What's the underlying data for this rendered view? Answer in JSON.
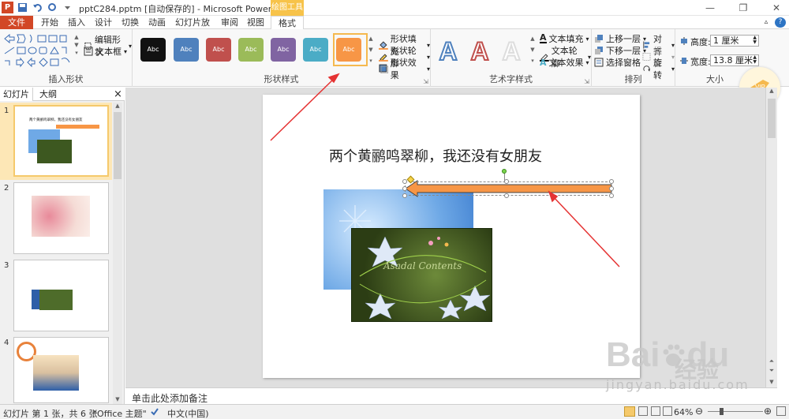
{
  "window": {
    "title": "pptC284.pptm [自动保存的] - Microsoft PowerPoint",
    "context_tab_title": "绘图工具",
    "app_icon": "P"
  },
  "tabs": [
    "文件",
    "开始",
    "插入",
    "设计",
    "切换",
    "动画",
    "幻灯片放映",
    "审阅",
    "视图",
    "格式"
  ],
  "ribbon": {
    "insert_shapes": {
      "edit_shape": "编辑形状",
      "text_box": "文本框",
      "label": "插入形状"
    },
    "shape_styles": {
      "swatches": [
        {
          "label": "Abc",
          "color": "#111111"
        },
        {
          "label": "Abc",
          "color": "#4f81bd"
        },
        {
          "label": "Abc",
          "color": "#c0504d"
        },
        {
          "label": "Abc",
          "color": "#9bbb59"
        },
        {
          "label": "Abc",
          "color": "#8064a2"
        },
        {
          "label": "Abc",
          "color": "#4bacc6"
        },
        {
          "label": "Abc",
          "color": "#f79646"
        }
      ],
      "fill": "形状填充",
      "outline": "形状轮廓",
      "effects": "形状效果",
      "label": "形状样式"
    },
    "wordart": {
      "samples": [
        {
          "text": "A",
          "color": "#4f81bd"
        },
        {
          "text": "A",
          "color": "#c0504d"
        },
        {
          "text": "A",
          "color": "#dddddd"
        }
      ],
      "text_fill": "文本填充",
      "text_outline": "文本轮廓",
      "text_effects": "文本效果",
      "label": "艺术字样式"
    },
    "arrange": {
      "bring_forward": "上移一层",
      "send_backward": "下移一层",
      "selection_pane": "选择窗格",
      "align": "对齐",
      "group": "组合",
      "rotate": "旋转",
      "label": "排列"
    },
    "size": {
      "height_label": "高度:",
      "height_value": "1 厘米",
      "width_label": "宽度:",
      "width_value": "13.8 厘米",
      "label": "大小"
    }
  },
  "left_panel": {
    "tab_slides": "幻灯片",
    "tab_outline": "大纲",
    "close": "×",
    "thumbnails": [
      {
        "num": "1",
        "title": "两个黄鹂鸣翠柳，我还没有女朋友"
      },
      {
        "num": "2"
      },
      {
        "num": "3"
      },
      {
        "num": "4"
      }
    ]
  },
  "slide": {
    "title": "两个黄鹂鸣翠柳，我还没有女朋友",
    "image_text": "Asadal Contents",
    "arrow_color": "#f79646"
  },
  "notes": {
    "placeholder": "单击此处添加备注"
  },
  "status_bar": {
    "slide_info": "幻灯片 第 1 张，共 6 张",
    "theme": "\"Office 主题\"",
    "language": "中文(中国)",
    "zoom": "64%"
  },
  "watermark": {
    "logo": "Bai",
    "logo_suffix": "du",
    "jingyan": "经验",
    "url": "jingyan.baidu.com"
  }
}
